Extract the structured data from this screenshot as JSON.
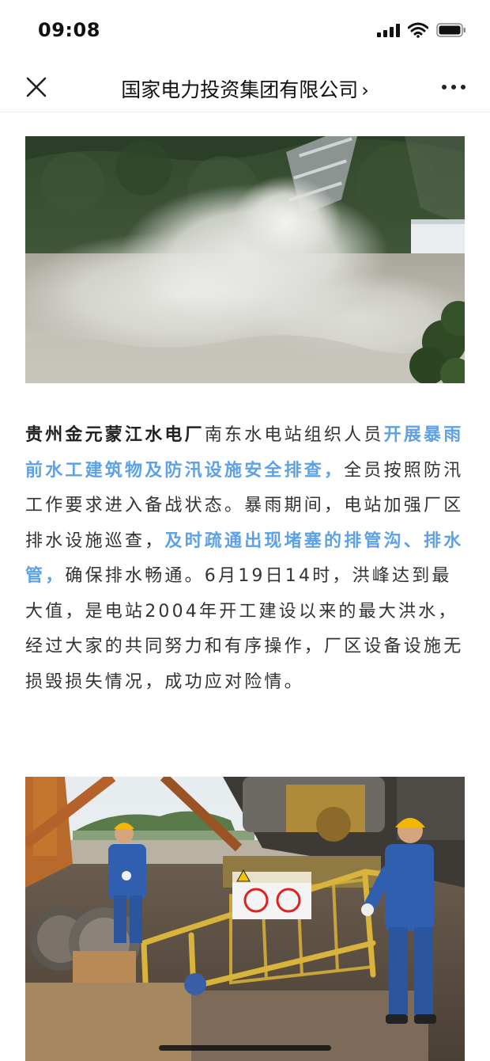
{
  "status_bar": {
    "time": "09:08",
    "icons": [
      "cellular-signal-icon",
      "wifi-icon",
      "battery-icon"
    ]
  },
  "nav": {
    "title": "国家电力投资集团有限公司",
    "chevron": "›",
    "icons": {
      "close": "close-icon",
      "more": "more-icon"
    }
  },
  "article": {
    "p1_strong": "贵州金元蒙江水电厂",
    "p1_a": "南东水电站组织人员",
    "p1_link1": "开展暴雨前水工建筑物及防汛设施安全排查，",
    "p1_b": "全员按照防汛工作要求进入备战状态。暴雨期间，电站加强厂区排水设施巡查，",
    "p1_link2": "及时疏通出现堵塞的排管沟、排水管，",
    "p1_c": "确保排水畅通。6月19日14时，洪峰达到最大值，是电站2004年开工建设以来的最大洪水，经过大家的共同努力和有序操作，厂区设备设施无损毁损失情况，成功应对险情。"
  },
  "colors": {
    "link": "#5da1e6",
    "text": "#333333",
    "workwear": "#2f5fae",
    "helmet": "#f2b705"
  }
}
